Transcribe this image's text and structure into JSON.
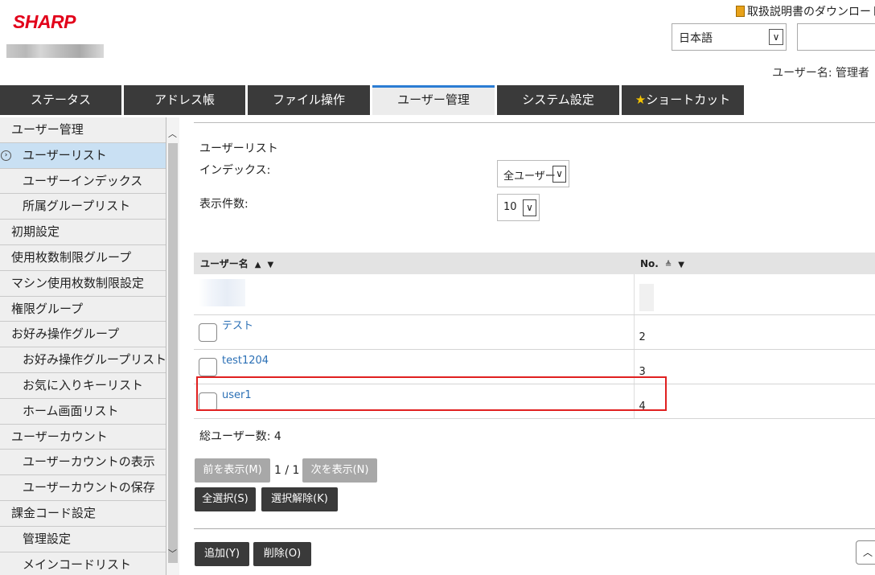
{
  "header": {
    "logo": "SHARP",
    "manual_link": "取扱説明書のダウンロード",
    "language": "日本語",
    "user_label": "ユーザー名: 管理者"
  },
  "tabs": [
    {
      "label": "ステータス"
    },
    {
      "label": "アドレス帳"
    },
    {
      "label": "ファイル操作"
    },
    {
      "label": "ユーザー管理"
    },
    {
      "label": "システム設定"
    },
    {
      "label": "ショートカット"
    }
  ],
  "sidebar": {
    "items": [
      {
        "label": "ユーザー管理"
      },
      {
        "label": "ユーザーリスト"
      },
      {
        "label": "ユーザーインデックス"
      },
      {
        "label": "所属グループリスト"
      },
      {
        "label": "初期設定"
      },
      {
        "label": "使用枚数制限グループ"
      },
      {
        "label": "マシン使用枚数制限設定"
      },
      {
        "label": "権限グループ"
      },
      {
        "label": "お好み操作グループ"
      },
      {
        "label": "お好み操作グループリスト"
      },
      {
        "label": "お気に入りキーリスト"
      },
      {
        "label": "ホーム画面リスト"
      },
      {
        "label": "ユーザーカウント"
      },
      {
        "label": "ユーザーカウントの表示"
      },
      {
        "label": "ユーザーカウントの保存"
      },
      {
        "label": "課金コード設定"
      },
      {
        "label": "管理設定"
      },
      {
        "label": "メインコードリスト"
      }
    ]
  },
  "main": {
    "title": "ユーザーリスト",
    "index_label": "インデックス:",
    "index_value": "全ユーザー",
    "count_label": "表示件数:",
    "count_value": "10",
    "table": {
      "headers": [
        "ユーザー名",
        "No."
      ],
      "sort_asc": "▲",
      "sort_filter": "▼",
      "sort_neutral": "≜",
      "rows": [
        {
          "name": "テスト",
          "no": "2"
        },
        {
          "name": "test1204",
          "no": "3"
        },
        {
          "name": "user1",
          "no": "4"
        }
      ]
    },
    "total_label": "総ユーザー数:",
    "total_value": "4",
    "prev_button": "前を表示(M)",
    "page_text": "1 / 1",
    "next_button": "次を表示(N)",
    "select_all_button": "全選択(S)",
    "deselect_button": "選択解除(K)",
    "add_button": "追加(Y)",
    "delete_button": "削除(O)"
  }
}
